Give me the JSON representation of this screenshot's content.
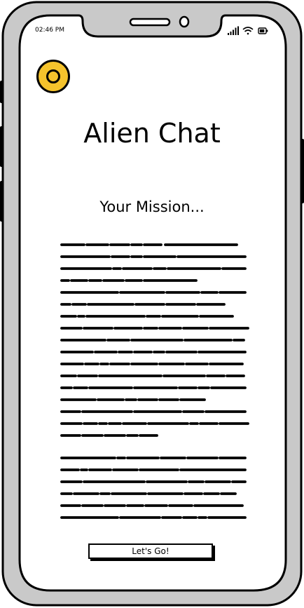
{
  "status_bar": {
    "time": "02:46 PM"
  },
  "app": {
    "title": "Alien Chat"
  },
  "mission": {
    "heading": "Your Mission..."
  },
  "actions": {
    "start_label": "Let's Go!"
  },
  "icons": {
    "avatar": "avatar-icon",
    "signal": "signal-icon",
    "wifi": "wifi-icon",
    "battery": "battery-icon"
  },
  "colors": {
    "avatar": "#f5c32c",
    "frame": "#c8c8c8",
    "ink": "#000000"
  }
}
